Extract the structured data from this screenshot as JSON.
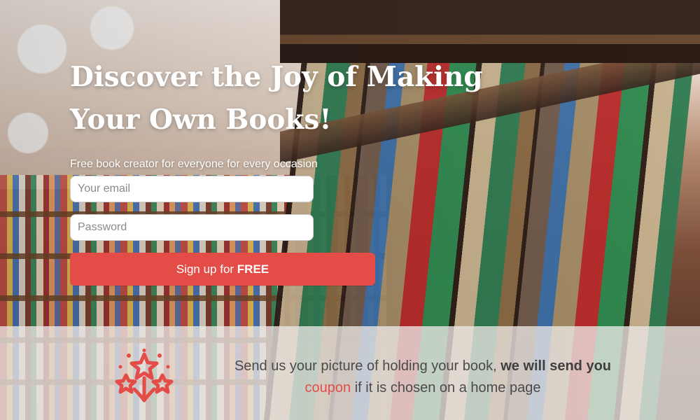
{
  "hero": {
    "title_line1": "Discover the Joy of Making",
    "title_line2": "Your Own Books!",
    "subtitle": "Free book creator for everyone for every occasion"
  },
  "form": {
    "email_placeholder": "Your email",
    "password_placeholder": "Password",
    "cta_prefix": "Sign up for ",
    "cta_strong": "FREE"
  },
  "banner": {
    "text_part1": "Send us your picture of holding your book, ",
    "text_bold": "we will send you",
    "coupon": "coupon",
    "text_part2": " if it is chosen on a home page"
  },
  "icons": {
    "banner_icon": "celebration-stars-icon"
  },
  "colors": {
    "accent": "#e44c48",
    "banner_bg": "#ece8e6",
    "text": "#4a4a4a"
  }
}
